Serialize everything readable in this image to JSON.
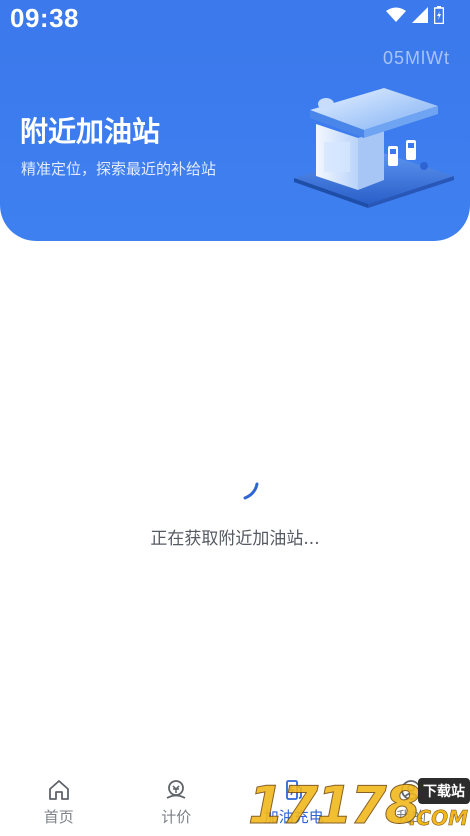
{
  "status_bar": {
    "time": "09:38",
    "icons": [
      "wifi-icon",
      "signal-icon",
      "battery-icon"
    ]
  },
  "hero": {
    "code": "05MlWt",
    "title": "附近加油站",
    "subtitle": "精准定位，探索最近的补给站",
    "illustration": "gas-station-illustration"
  },
  "loading": {
    "text": "正在获取附近加油站..."
  },
  "bottom_nav": {
    "items": [
      {
        "label": "首页",
        "icon": "home-icon",
        "active": false
      },
      {
        "label": "计价",
        "icon": "pricing-icon",
        "active": false
      },
      {
        "label": "加油充电",
        "icon": "fuel-icon",
        "active": true
      },
      {
        "label": "我的",
        "icon": "profile-icon",
        "active": false
      }
    ]
  },
  "watermark": {
    "number": "17178",
    "badge": "下载站",
    "domain": ".COM"
  },
  "colors": {
    "primary": "#3b79ec",
    "active_nav": "#2f66d6",
    "inactive_nav": "#7d828a"
  }
}
